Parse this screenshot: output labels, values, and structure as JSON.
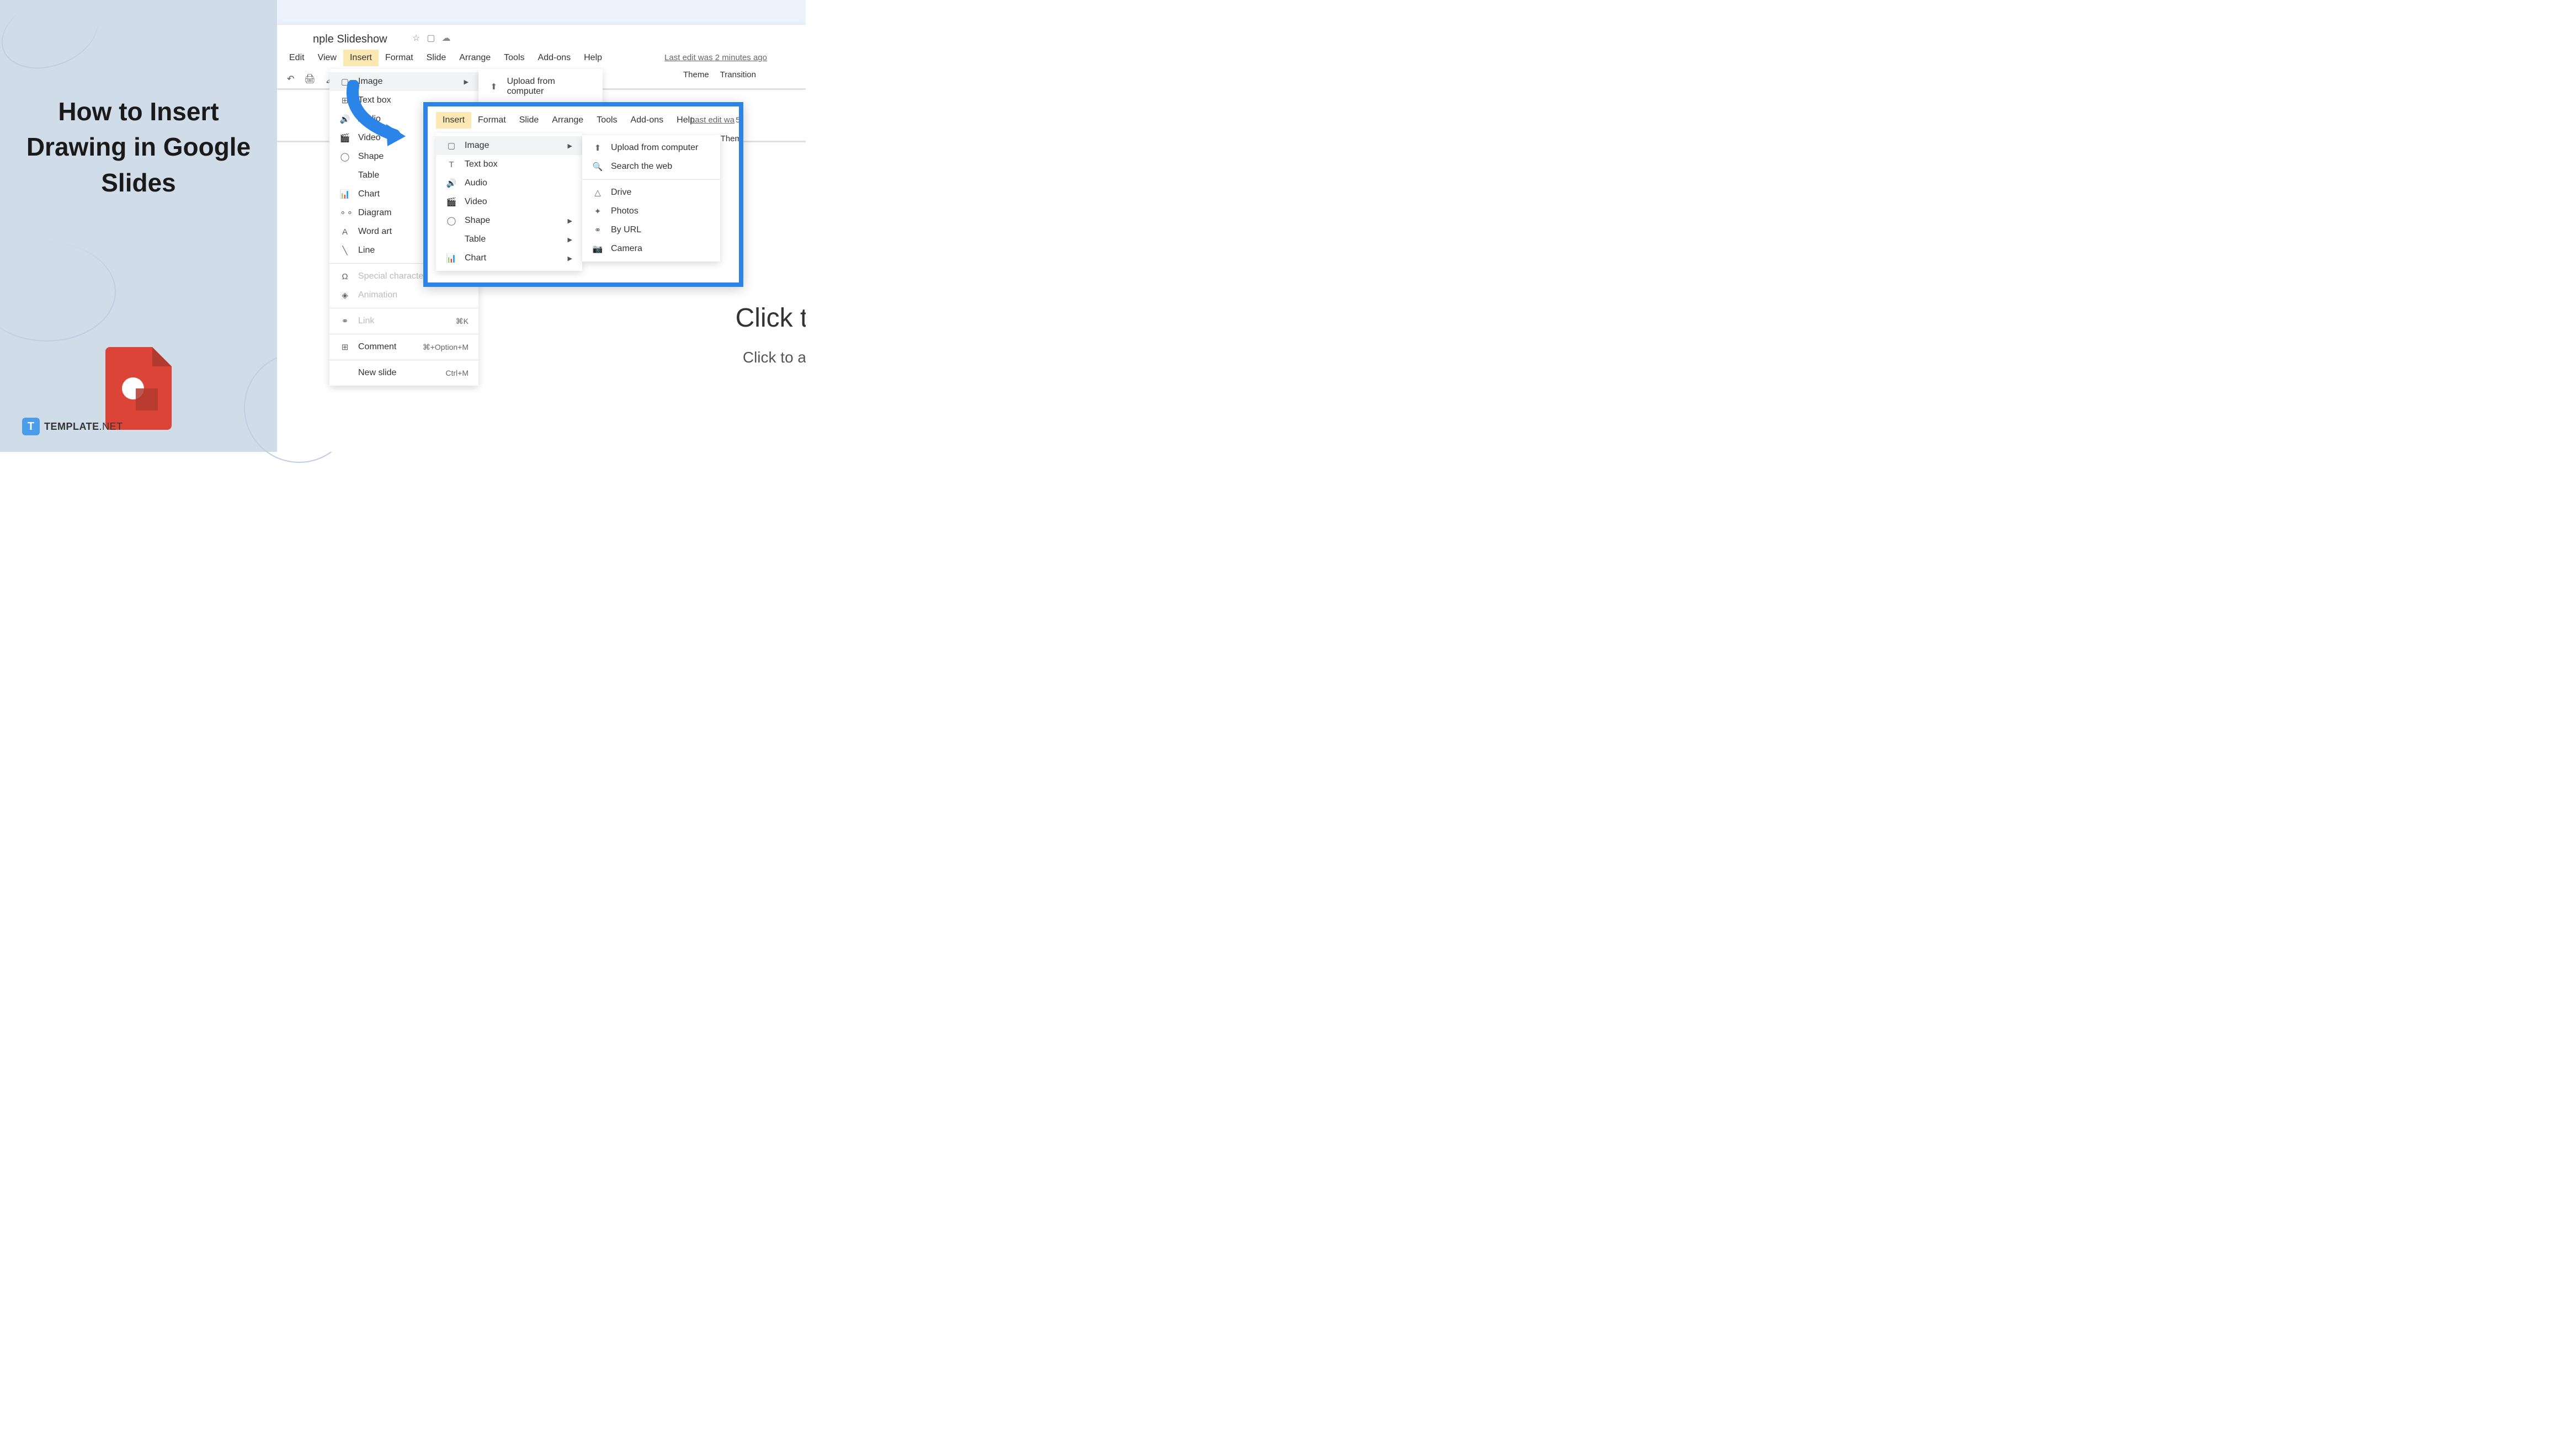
{
  "leftPanel": {
    "title": "How to Insert Drawing in Google Slides",
    "brand": {
      "iconLetter": "T",
      "textBold": "TEMPLATE",
      "textLight": ".NET"
    }
  },
  "slides": {
    "docTitle": "nple Slideshow",
    "lastEdit": "Last edit was 2 minutes ago",
    "menubar": [
      "Edit",
      "View",
      "Insert",
      "Format",
      "Slide",
      "Arrange",
      "Tools",
      "Add-ons",
      "Help"
    ],
    "theme": "Theme",
    "transition": "Transition",
    "slideTitle": "Click to",
    "slideSubtitle": "Click to ac"
  },
  "menu1": {
    "items": [
      {
        "icon": "▢",
        "label": "Image",
        "arrow": true,
        "hover": true
      },
      {
        "icon": "⊞",
        "label": "Text box"
      },
      {
        "icon": "🔊",
        "label": "Audio"
      },
      {
        "icon": "🎬",
        "label": "Video"
      },
      {
        "icon": "◯",
        "label": "Shape"
      },
      {
        "icon": "",
        "label": "Table"
      },
      {
        "icon": "📊",
        "label": "Chart"
      },
      {
        "icon": "⚬⚬",
        "label": "Diagram"
      },
      {
        "icon": "A",
        "label": "Word art"
      },
      {
        "icon": "╲",
        "label": "Line"
      }
    ],
    "group2": [
      {
        "icon": "Ω",
        "label": "Special characters",
        "disabled": true
      },
      {
        "icon": "◈",
        "label": "Animation",
        "disabled": true
      }
    ],
    "group3": [
      {
        "icon": "⚭",
        "label": "Link",
        "shortcut": "⌘K",
        "disabled": true
      }
    ],
    "group4": [
      {
        "icon": "⊞",
        "label": "Comment",
        "shortcut": "⌘+Option+M"
      }
    ],
    "group5": [
      {
        "icon": "",
        "label": "New slide",
        "shortcut": "Ctrl+M"
      }
    ]
  },
  "submenu1": {
    "items": [
      {
        "icon": "⬆",
        "label": "Upload from computer"
      }
    ]
  },
  "inset": {
    "menubar": [
      "Insert",
      "Format",
      "Slide",
      "Arrange",
      "Tools",
      "Add-ons",
      "Help"
    ],
    "lastEdit": "Last edit wa",
    "theme": "Them",
    "slideNum": "5"
  },
  "menu2": {
    "items": [
      {
        "icon": "▢",
        "label": "Image",
        "arrow": true,
        "hover": true
      },
      {
        "icon": "T",
        "label": "Text box"
      },
      {
        "icon": "🔊",
        "label": "Audio"
      },
      {
        "icon": "🎬",
        "label": "Video"
      },
      {
        "icon": "◯",
        "label": "Shape",
        "arrow": true
      },
      {
        "icon": "",
        "label": "Table",
        "arrow": true
      },
      {
        "icon": "📊",
        "label": "Chart",
        "arrow": true
      }
    ]
  },
  "submenu2": {
    "items": [
      {
        "icon": "⬆",
        "label": "Upload from computer"
      },
      {
        "icon": "🔍",
        "label": "Search the web"
      }
    ],
    "group2": [
      {
        "icon": "△",
        "label": "Drive"
      },
      {
        "icon": "✦",
        "label": "Photos"
      },
      {
        "icon": "⚭",
        "label": "By URL"
      },
      {
        "icon": "📷",
        "label": "Camera"
      }
    ]
  }
}
